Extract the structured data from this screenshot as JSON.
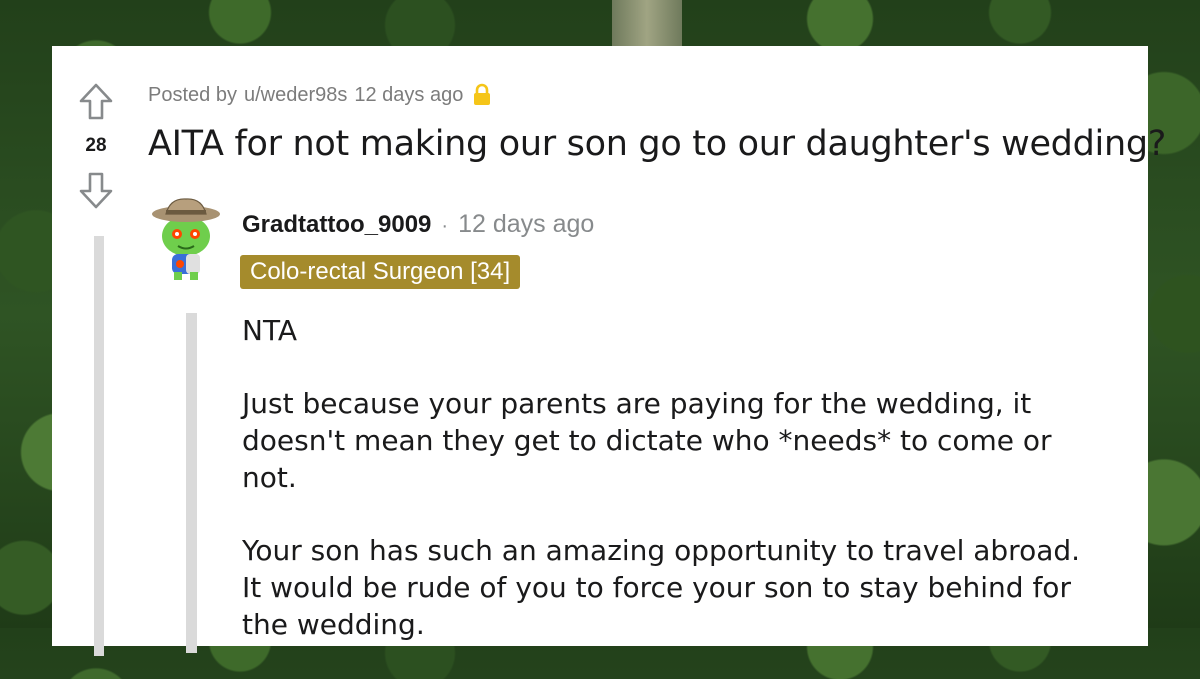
{
  "post": {
    "score": "28",
    "meta_prefix": "Posted by",
    "author": "u/weder98s",
    "time": "12 days ago",
    "title": "AITA for not making our son go to our daughter's wedding?"
  },
  "comment": {
    "author": "Gradtattoo_9009",
    "separator": "·",
    "time": "12 days ago",
    "flair": "Colo-rectal Surgeon [34]",
    "paragraphs": [
      "NTA",
      "Just because your parents are paying for the wedding, it doesn't mean they get to dictate who *needs* to come or not.",
      "Your son has such an amazing opportunity to travel abroad. It would be rude of you to force your son to stay behind for the wedding."
    ]
  },
  "colors": {
    "flair_bg": "#a58b2c",
    "lock": "#f5c518",
    "text": "#1a1a1b",
    "meta": "#7c7c7c"
  },
  "icons": {
    "upvote": "upvote-arrow-icon",
    "downvote": "downvote-arrow-icon",
    "lock": "lock-icon",
    "avatar": "snoo-avatar-icon"
  }
}
